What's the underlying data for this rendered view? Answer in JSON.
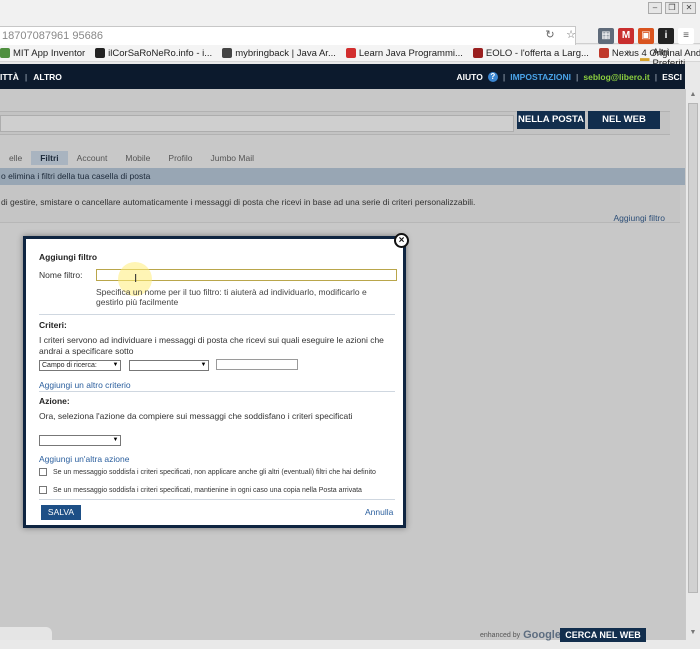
{
  "browser": {
    "url": "18707087961 95686",
    "bookmarks": [
      {
        "label": "MIT App Inventor",
        "color": "#4f8f3f"
      },
      {
        "label": "ilCorSaRoNeRo.info - i...",
        "color": "#222222"
      },
      {
        "label": "mybringback | Java Ar...",
        "color": "#444444"
      },
      {
        "label": "Learn Java Programmi...",
        "color": "#d22e2e"
      },
      {
        "label": "EOLO - l'offerta a Larg...",
        "color": "#9a1f1f"
      },
      {
        "label": "Nexus 4 Original Andr...",
        "color": "#c0392b"
      }
    ],
    "more_label": "»",
    "folder_label": "Altri Preferiti"
  },
  "topnav": {
    "left": [
      "ITTÀ",
      "ALTRO"
    ],
    "help_label": "AIUTO",
    "help_icon": "?",
    "settings_label": "IMPOSTAZIONI",
    "user_email": "seblog@libero.it",
    "logout_label": "ESCI"
  },
  "page": {
    "search_mail_btn": "NELLA POSTA",
    "search_web_btn": "NEL WEB",
    "tabs": [
      "elle",
      "Filtri",
      "Account",
      "Mobile",
      "Profilo",
      "Jumbo Mail"
    ],
    "active_tab_index": 1,
    "band_text": "o elimina i filtri della tua casella di posta",
    "description": "di gestire, smistare o cancellare automaticamente i messaggi di posta che ricevi in base ad una serie di criteri personalizzabili.",
    "add_filter_link": "Aggiungi filtro",
    "enhanced_by": "enhanced by",
    "google_word": "Google",
    "bottom_search_btn": "CERCA NEL WEB"
  },
  "modal": {
    "title": "Aggiungi filtro",
    "name_label": "Nome filtro:",
    "name_value": "",
    "name_hint": "Specifica un nome per il tuo filtro: ti aiuterà ad individuarlo, modificarlo e gestirlo più facilmente",
    "criteria_title": "Criteri:",
    "criteria_text": "I criteri servono ad individuare i messaggi di posta che ricevi sui quali eseguire le azioni che andrai a specificare sotto",
    "search_field_select": "Campo di ricerca:",
    "operator_select": "",
    "criteria_value": "",
    "add_criteria_link": "Aggiungi un altro criterio",
    "actions_title": "Azione:",
    "actions_text": "Ora, seleziona l'azione da compiere sui messaggi che soddisfano i criteri specificati",
    "action_select": "",
    "add_action_link": "Aggiungi un'altra azione",
    "checkbox1": "Se un messaggio soddisfa i criteri specificati, non applicare anche gli altri (eventuali) filtri che hai definito",
    "checkbox2": "Se un messaggio soddisfa i criteri specificati, mantienine in ogni caso una copia nella Posta arrivata",
    "save_label": "SALVA",
    "cancel_label": "Annulla",
    "close_label": "×"
  },
  "colors": {
    "nav_bg": "#0c1a2d",
    "button_dark": "#122e4d",
    "modal_border": "#0f2541",
    "link": "#2b5f9e"
  }
}
